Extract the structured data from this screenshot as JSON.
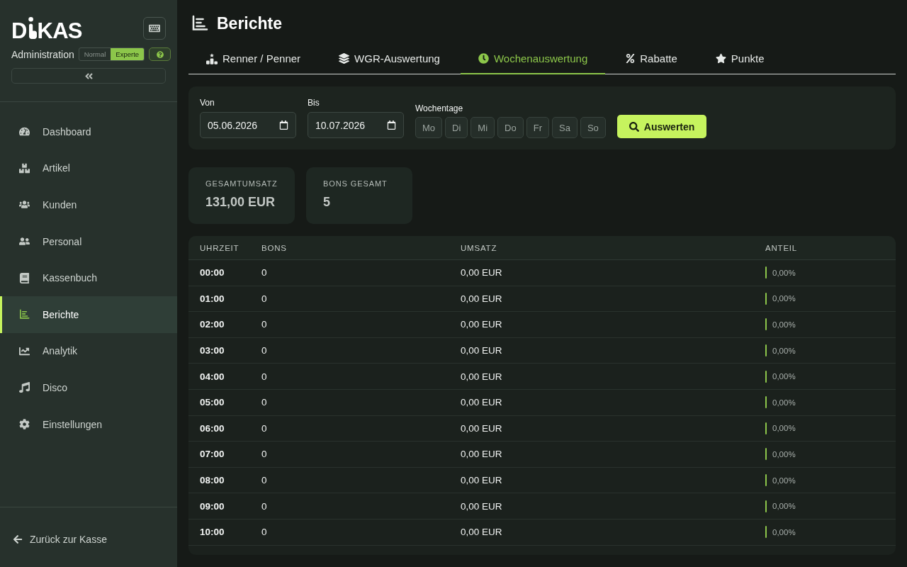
{
  "sidebar": {
    "logo": {
      "before": "D",
      "after": "KAS"
    },
    "subtitle": "Administration",
    "modes": [
      {
        "label": "Normal",
        "selected": false
      },
      {
        "label": "Experte",
        "selected": true
      }
    ],
    "nav": [
      {
        "label": "Dashboard",
        "selected": false
      },
      {
        "label": "Artikel",
        "selected": false
      },
      {
        "label": "Kunden",
        "selected": false
      },
      {
        "label": "Personal",
        "selected": false
      },
      {
        "label": "Kassenbuch",
        "selected": false
      },
      {
        "label": "Berichte",
        "selected": true
      },
      {
        "label": "Analytik",
        "selected": false
      },
      {
        "label": "Disco",
        "selected": false
      },
      {
        "label": "Einstellungen",
        "selected": false
      }
    ],
    "back_link": "Zurück zur Kasse"
  },
  "page": {
    "title": "Berichte"
  },
  "tabs": [
    {
      "label": "Renner / Penner",
      "selected": false
    },
    {
      "label": "WGR-Auswertung",
      "selected": false
    },
    {
      "label": "Wochenauswertung",
      "selected": true
    },
    {
      "label": "Rabatte",
      "selected": false
    },
    {
      "label": "Punkte",
      "selected": false
    }
  ],
  "filters": {
    "from": {
      "label": "Von",
      "value": "05.06.2026"
    },
    "to": {
      "label": "Bis",
      "value": "10.07.2026"
    },
    "weekdays": {
      "label": "Wochentage",
      "days": [
        {
          "label": "Mo",
          "selected": false
        },
        {
          "label": "Di",
          "selected": false
        },
        {
          "label": "Mi",
          "selected": false
        },
        {
          "label": "Do",
          "selected": false
        },
        {
          "label": "Fr",
          "selected": false
        },
        {
          "label": "Sa",
          "selected": false
        },
        {
          "label": "So",
          "selected": false
        }
      ]
    },
    "submit": "Auswerten"
  },
  "stats": [
    {
      "label": "GESAMTUMSATZ",
      "value": "131,00 EUR"
    },
    {
      "label": "BONS GESAMT",
      "value": "5"
    }
  ],
  "table": {
    "columns": [
      "UHRZEIT",
      "BONS",
      "UMSATZ",
      "ANTEIL"
    ],
    "rows": [
      {
        "time": "00:00",
        "bons": "0",
        "revenue": "0,00 EUR",
        "share": "0,00%"
      },
      {
        "time": "01:00",
        "bons": "0",
        "revenue": "0,00 EUR",
        "share": "0,00%"
      },
      {
        "time": "02:00",
        "bons": "0",
        "revenue": "0,00 EUR",
        "share": "0,00%"
      },
      {
        "time": "03:00",
        "bons": "0",
        "revenue": "0,00 EUR",
        "share": "0,00%"
      },
      {
        "time": "04:00",
        "bons": "0",
        "revenue": "0,00 EUR",
        "share": "0,00%"
      },
      {
        "time": "05:00",
        "bons": "0",
        "revenue": "0,00 EUR",
        "share": "0,00%"
      },
      {
        "time": "06:00",
        "bons": "0",
        "revenue": "0,00 EUR",
        "share": "0,00%"
      },
      {
        "time": "07:00",
        "bons": "0",
        "revenue": "0,00 EUR",
        "share": "0,00%"
      },
      {
        "time": "08:00",
        "bons": "0",
        "revenue": "0,00 EUR",
        "share": "0,00%"
      },
      {
        "time": "09:00",
        "bons": "0",
        "revenue": "0,00 EUR",
        "share": "0,00%"
      },
      {
        "time": "10:00",
        "bons": "0",
        "revenue": "0,00 EUR",
        "share": "0,00%"
      }
    ]
  }
}
